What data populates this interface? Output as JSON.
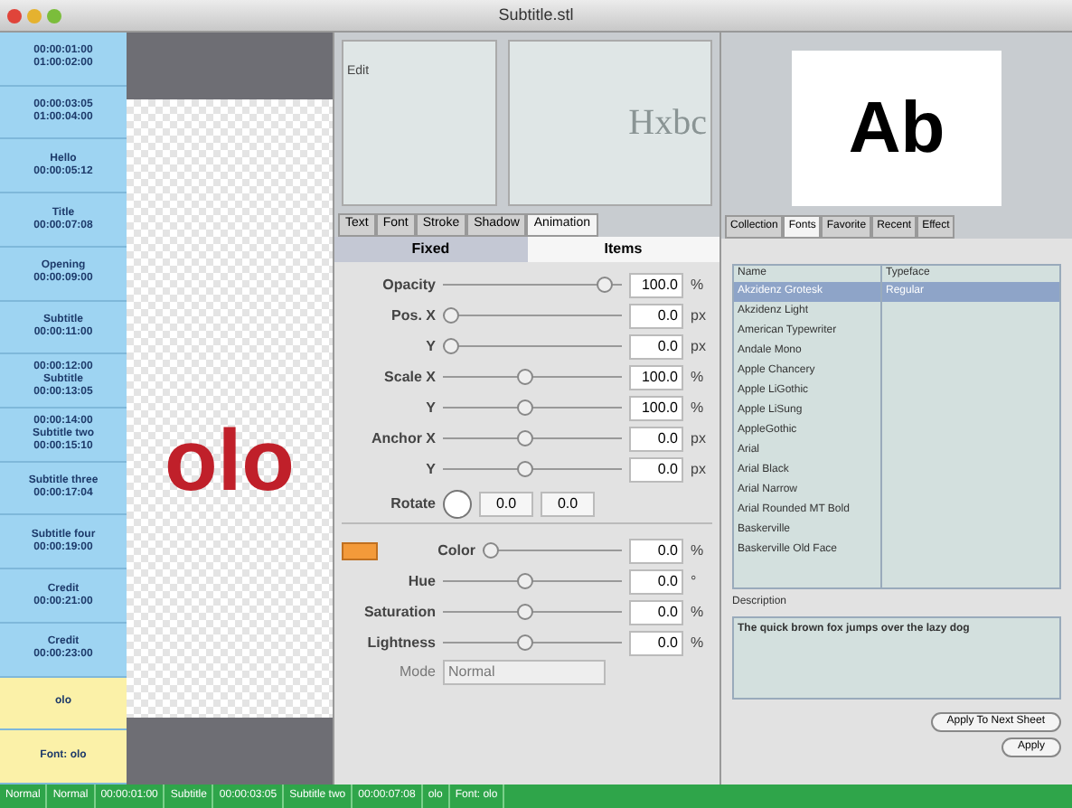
{
  "window": {
    "title": "Subtitle.stl"
  },
  "sidebar": {
    "items": [
      {
        "lines": [
          "00:00:01:00",
          "01:00:02:00"
        ],
        "selected": false
      },
      {
        "lines": [
          "00:00:03:05",
          "01:00:04:00"
        ],
        "selected": false
      },
      {
        "lines": [
          "Hello",
          "00:00:05:12"
        ],
        "selected": false
      },
      {
        "lines": [
          "Title",
          "00:00:07:08"
        ],
        "selected": false
      },
      {
        "lines": [
          "Opening",
          "00:00:09:00"
        ],
        "selected": false
      },
      {
        "lines": [
          "Subtitle",
          "00:00:11:00"
        ],
        "selected": false
      },
      {
        "lines": [
          "00:00:12:00",
          "Subtitle",
          "00:00:13:05"
        ],
        "selected": false
      },
      {
        "lines": [
          "00:00:14:00",
          "Subtitle two",
          "00:00:15:10"
        ],
        "selected": false
      },
      {
        "lines": [
          "Subtitle three",
          "00:00:17:04"
        ],
        "selected": false
      },
      {
        "lines": [
          "Subtitle four",
          "00:00:19:00"
        ],
        "selected": false
      },
      {
        "lines": [
          "Credit",
          "00:00:21:00"
        ],
        "selected": false
      },
      {
        "lines": [
          "Credit",
          "00:00:23:00"
        ],
        "selected": false
      },
      {
        "lines": [
          "olo"
        ],
        "selected": true
      },
      {
        "lines": [
          "Font: olo"
        ],
        "selected": true
      }
    ]
  },
  "canvas": {
    "caption": "olo"
  },
  "preview": {
    "label": "Edit",
    "sample": "Hxbc"
  },
  "style_tabs": [
    {
      "label": "Text",
      "selected": false
    },
    {
      "label": "Font",
      "selected": false
    },
    {
      "label": "Stroke",
      "selected": false
    },
    {
      "label": "Shadow",
      "selected": false
    },
    {
      "label": "Animation",
      "selected": true
    }
  ],
  "mode_tabs": [
    {
      "label": "Fixed",
      "selected": true
    },
    {
      "label": "Items",
      "selected": false
    }
  ],
  "sliders": [
    {
      "label": "Opacity",
      "level": 0.95,
      "reading": "100.0",
      "unit": "%"
    },
    {
      "label": "Pos. X",
      "level": 0.0,
      "reading": "0.0",
      "unit": "px"
    },
    {
      "label": "Y",
      "level": 0.0,
      "reading": "0.0",
      "unit": "px"
    },
    {
      "label": "Scale X",
      "level": 0.45,
      "reading": "100.0",
      "unit": "%"
    },
    {
      "label": "Y",
      "level": 0.45,
      "reading": "100.0",
      "unit": "%"
    },
    {
      "label": "Anchor X",
      "level": 0.45,
      "reading": "0.0",
      "unit": "px"
    },
    {
      "label": "Y",
      "level": 0.45,
      "reading": "0.0",
      "unit": "px"
    }
  ],
  "rotate": {
    "label": "Rotate",
    "value": "0.0",
    "reading": "0.0"
  },
  "color_rows": [
    {
      "label": "Color",
      "level": 0.0,
      "reading": "0.0",
      "unit": "%"
    },
    {
      "label": "Hue",
      "level": 0.45,
      "reading": "0.0",
      "unit": "°"
    },
    {
      "label": "Saturation",
      "level": 0.45,
      "reading": "0.0",
      "unit": "%"
    },
    {
      "label": "Lightness",
      "level": 0.45,
      "reading": "0.0",
      "unit": "%"
    }
  ],
  "blend": {
    "label": "Mode",
    "value": "Normal"
  },
  "font_preview": "Ab",
  "font_tabs": [
    {
      "label": "Collection",
      "selected": false
    },
    {
      "label": "Fonts",
      "selected": true
    },
    {
      "label": "Favorite",
      "selected": false
    },
    {
      "label": "Recent",
      "selected": false
    },
    {
      "label": "Effect",
      "selected": false
    }
  ],
  "font_list": {
    "columns": [
      "Name",
      "Typeface"
    ],
    "names": [
      {
        "label": "Akzidenz Grotesk",
        "selected": true
      },
      {
        "label": "Akzidenz Light",
        "selected": false
      },
      {
        "label": "American Typewriter",
        "selected": false
      },
      {
        "label": "Andale Mono",
        "selected": false
      },
      {
        "label": "Apple Chancery",
        "selected": false
      },
      {
        "label": "Apple LiGothic",
        "selected": false
      },
      {
        "label": "Apple LiSung",
        "selected": false
      },
      {
        "label": "AppleGothic",
        "selected": false
      },
      {
        "label": "Arial",
        "selected": false
      },
      {
        "label": "Arial Black",
        "selected": false
      },
      {
        "label": "Arial Narrow",
        "selected": false
      },
      {
        "label": "Arial Rounded MT Bold",
        "selected": false
      },
      {
        "label": "Baskerville",
        "selected": false
      },
      {
        "label": "Baskerville Old Face",
        "selected": false
      }
    ],
    "typefaces": [
      {
        "label": "Regular",
        "selected": true
      }
    ]
  },
  "description": {
    "label": "Description",
    "text": "The quick brown fox jumps over the lazy dog"
  },
  "buttons": [
    {
      "label": "Apply To Next Sheet"
    },
    {
      "label": "Apply"
    }
  ],
  "status_bar": [
    "Normal",
    "Normal",
    "00:00:01:00",
    "Subtitle",
    "00:00:03:05",
    "Subtitle two",
    "00:00:07:08",
    "olo",
    "Font: olo"
  ]
}
